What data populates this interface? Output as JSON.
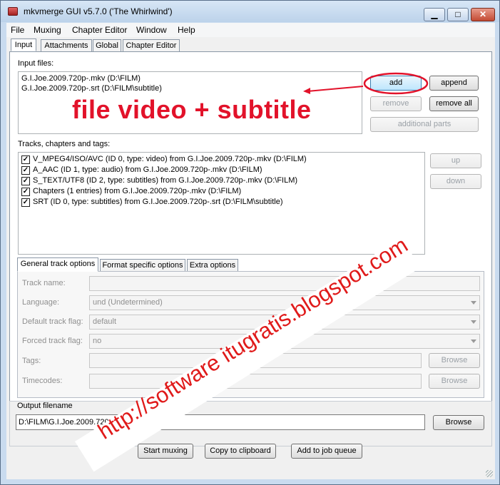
{
  "window": {
    "title": "mkvmerge GUI v5.7.0 ('The Whirlwind')",
    "controls": {
      "minimize": "▁",
      "maximize": "□",
      "close": "✕"
    }
  },
  "menu": [
    "File",
    "Muxing",
    "Chapter Editor",
    "Window",
    "Help"
  ],
  "tabs": [
    "Input",
    "Attachments",
    "Global",
    "Chapter Editor"
  ],
  "input_files": {
    "label": "Input files:",
    "files": [
      "G.I.Joe.2009.720p-.mkv (D:\\FILM)",
      "G.I.Joe.2009.720p-.srt (D:\\FILM\\subtitle)"
    ],
    "buttons": {
      "add": "add",
      "append": "append",
      "remove": "remove",
      "remove_all": "remove all",
      "additional_parts": "additional parts"
    }
  },
  "tracks": {
    "label": "Tracks, chapters and tags:",
    "items": [
      "V_MPEG4/ISO/AVC (ID 0, type: video) from G.I.Joe.2009.720p-.mkv (D:\\FILM)",
      "A_AAC (ID 1, type: audio) from G.I.Joe.2009.720p-.mkv (D:\\FILM)",
      "S_TEXT/UTF8 (ID 2, type: subtitles) from G.I.Joe.2009.720p-.mkv (D:\\FILM)",
      "Chapters (1 entries) from G.I.Joe.2009.720p-.mkv (D:\\FILM)",
      "SRT (ID 0, type: subtitles) from G.I.Joe.2009.720p-.srt (D:\\FILM\\subtitle)"
    ],
    "up": "up",
    "down": "down"
  },
  "track_tabs": [
    "General track options",
    "Format specific options",
    "Extra options"
  ],
  "track_options": {
    "track_name_label": "Track name:",
    "language_label": "Language:",
    "language_value": "und (Undetermined)",
    "default_flag_label": "Default track flag:",
    "default_flag_value": "default",
    "forced_flag_label": "Forced track flag:",
    "forced_flag_value": "no",
    "tags_label": "Tags:",
    "timecodes_label": "Timecodes:",
    "browse": "Browse"
  },
  "output": {
    "label": "Output filename",
    "value": "D:\\FILM\\G.I.Joe.2009.720p-.mkv",
    "browse": "Browse"
  },
  "actions": {
    "start_muxing": "Start muxing",
    "copy_to_clipboard": "Copy to clipboard",
    "add_to_job_queue": "Add to job queue"
  },
  "annotation": {
    "caption": "file video + subtitle",
    "watermark": "http://software itugratis.blogspot.com",
    "color": "#e2122a"
  }
}
